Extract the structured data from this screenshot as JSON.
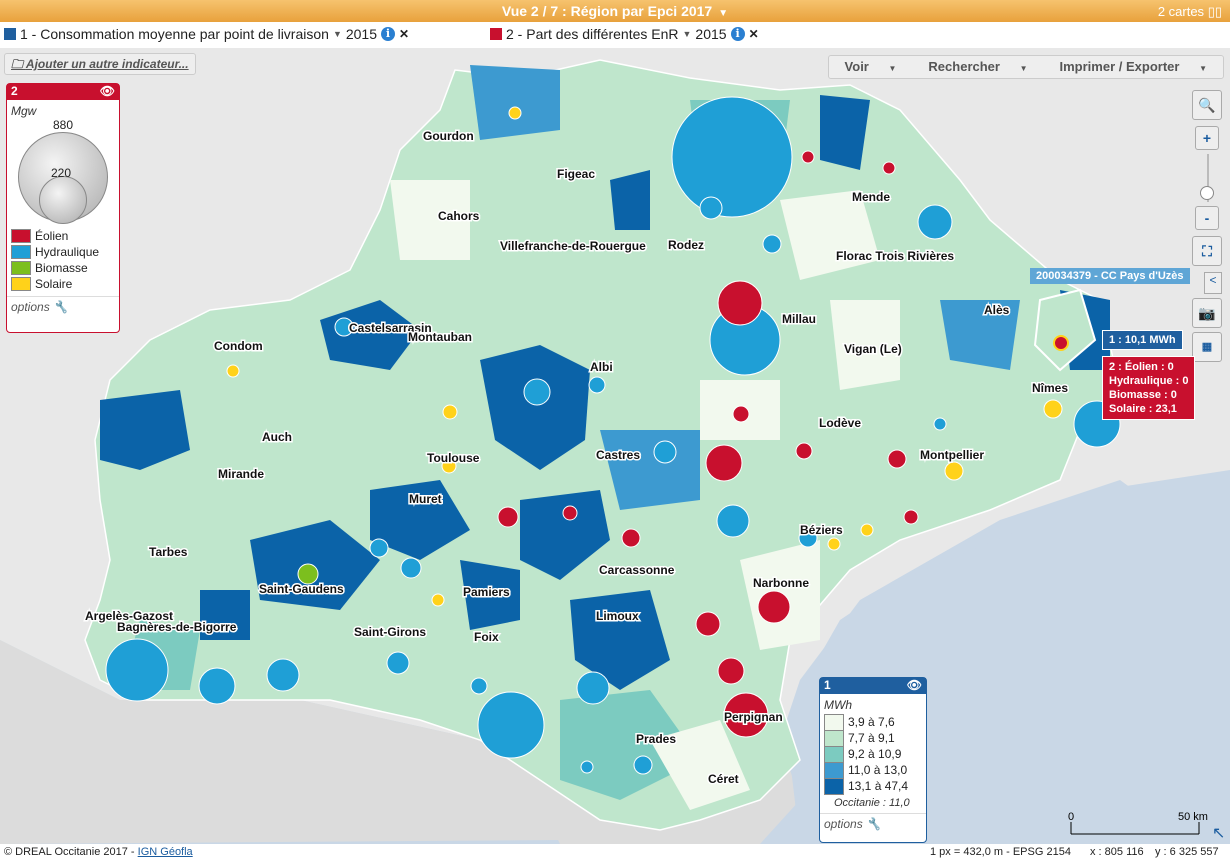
{
  "title_bar": {
    "view_title": "Vue 2 / 7 : Région par Epci 2017",
    "cards": "2 cartes"
  },
  "indicator1": {
    "label": "1 - Consommation moyenne par point de livraison",
    "year": "2015",
    "color": "#1f5f9f"
  },
  "indicator2": {
    "label": "2 - Part des différentes EnR",
    "year": "2015",
    "color": "#c8102e"
  },
  "add_indicator": "Ajouter un autre indicateur...",
  "menu": {
    "voir": "Voir",
    "rechercher": "Rechercher",
    "imprimer": "Imprimer / Exporter"
  },
  "legend2": {
    "number": "2",
    "unit": "Mgw",
    "size_high": "880",
    "size_low": "220",
    "items": [
      {
        "label": "Éolien",
        "color": "#c8102e"
      },
      {
        "label": "Hydraulique",
        "color": "#1f9fd6"
      },
      {
        "label": "Biomasse",
        "color": "#7cbf1e"
      },
      {
        "label": "Solaire",
        "color": "#ffd21a"
      }
    ],
    "options": "options"
  },
  "legend1": {
    "number": "1",
    "unit": "MWh",
    "classes": [
      {
        "label": "3,9 à 7,6",
        "color": "#f2f9ee"
      },
      {
        "label": "7,7 à 9,1",
        "color": "#bfe6cc"
      },
      {
        "label": "9,2 à 10,9",
        "color": "#7ccbc0"
      },
      {
        "label": "11,0 à 13,0",
        "color": "#3d9ad0"
      },
      {
        "label": "13,1 à 47,4",
        "color": "#0b63a8"
      }
    ],
    "reference": "Occitanie : 11,0",
    "options": "options"
  },
  "tooltip": {
    "title": "200034379 - CC Pays d'Uzès",
    "ind1": "1 : 10,1 MWh",
    "ind2_lines": [
      "2 : Éolien : 0",
      "Hydraulique : 0",
      "Biomasse : 0",
      "Solaire : 23,1"
    ]
  },
  "cities": [
    "Gourdon",
    "Figeac",
    "Cahors",
    "Villefranche-de-Rouergue",
    "Rodez",
    "Mende",
    "Florac Trois Rivières",
    "Alès",
    "Millau",
    "Castelsarrasin",
    "Montauban",
    "Condom",
    "Albi",
    "Vigan (Le)",
    "Nîmes",
    "Auch",
    "Toulouse",
    "Castres",
    "Lodève",
    "Mirande",
    "Montpellier",
    "Muret",
    "Béziers",
    "Tarbes",
    "Saint-Gaudens",
    "Carcassonne",
    "Narbonne",
    "Argelès-Gazost",
    "Bagnères-de-Bigorre",
    "Pamiers",
    "Limoux",
    "Saint-Girons",
    "Foix",
    "Perpignan",
    "Prades",
    "Céret"
  ],
  "scale": {
    "zero": "0",
    "end": "50 km"
  },
  "footer": {
    "credit": "© DREAL Occitanie 2017 - ",
    "link": "IGN Géofla",
    "info": "1 px = 432,0 m - EPSG 2154",
    "x": "x : 805 116",
    "y": "y : 6 325 557"
  }
}
